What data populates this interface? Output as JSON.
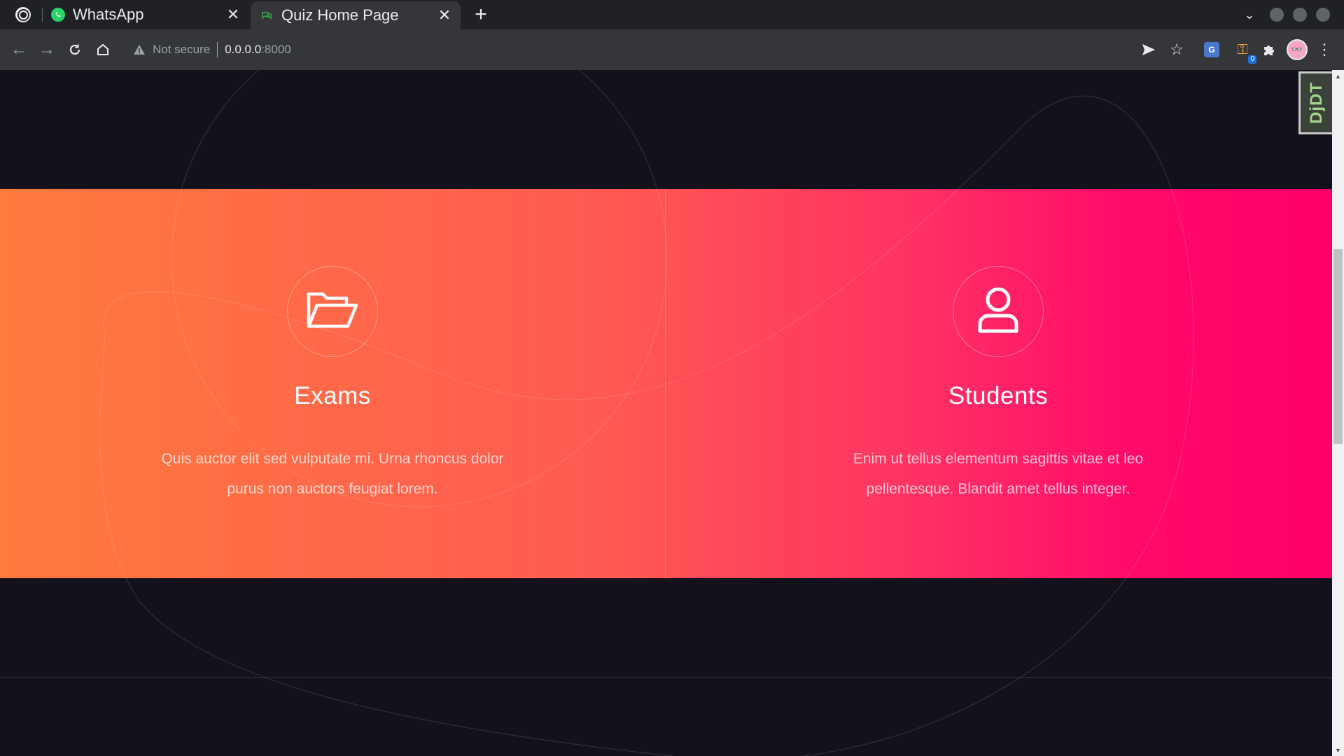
{
  "browser": {
    "tabs": [
      {
        "title": "WhatsApp",
        "favicon": "whatsapp-icon",
        "active": false
      },
      {
        "title": "Quiz Home Page",
        "favicon": "page-icon",
        "active": true
      }
    ],
    "new_tab_label": "+",
    "address_bar": {
      "security_label": "Not secure",
      "host": "0.0.0.0",
      "port": ":8000"
    },
    "profile_initial": "👓",
    "extension_badge": "0",
    "translate_label": "G"
  },
  "debug_toolbar": {
    "label": "DjDT"
  },
  "features": [
    {
      "title": "Exams",
      "icon": "folder-open-icon",
      "description": "Quis auctor elit sed vulputate mi. Urna rhoncus dolor purus non auctors feugiat lorem."
    },
    {
      "title": "Students",
      "icon": "user-icon",
      "description": "Enim ut tellus elementum sagittis vitae et leo pellentesque. Blandit amet tellus integer."
    }
  ],
  "colors": {
    "gradient_start": "#ff7a3d",
    "gradient_end": "#ff0068",
    "page_background": "#13111c"
  }
}
